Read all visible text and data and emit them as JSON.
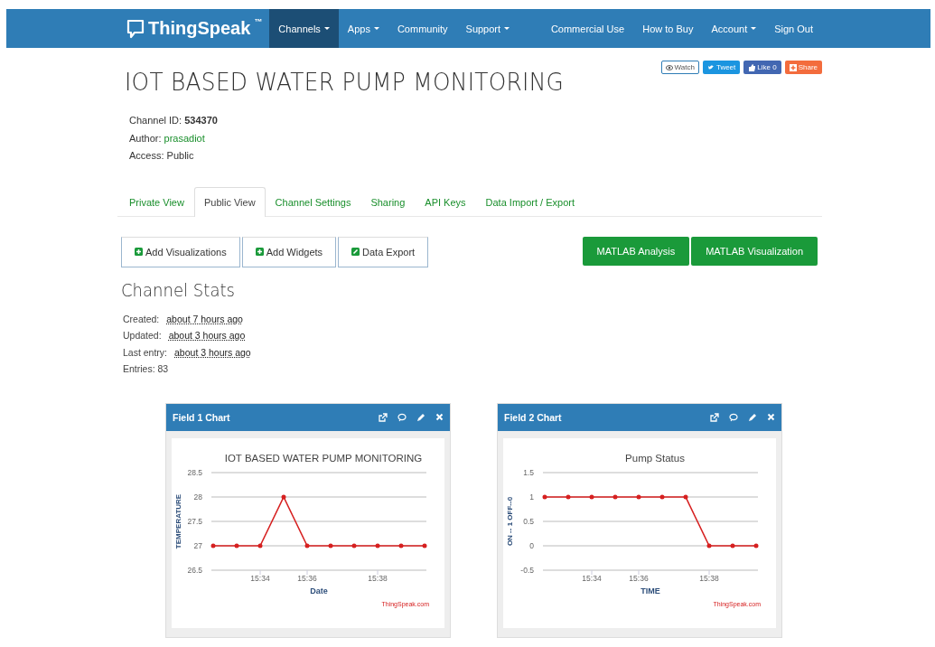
{
  "navbar": {
    "brand": "ThingSpeak",
    "trademark": "™",
    "items": [
      {
        "label": "Channels",
        "dropdown": true,
        "selected": true
      },
      {
        "label": "Apps",
        "dropdown": true,
        "selected": false
      },
      {
        "label": "Community",
        "dropdown": false,
        "selected": false
      },
      {
        "label": "Support",
        "dropdown": true,
        "selected": false
      }
    ],
    "right_items": [
      {
        "label": "Commercial Use",
        "dropdown": false,
        "selected": false
      },
      {
        "label": "How to Buy",
        "dropdown": false,
        "selected": false
      },
      {
        "label": "Account",
        "dropdown": true,
        "selected": false
      },
      {
        "label": "Sign Out",
        "dropdown": false,
        "selected": false
      }
    ]
  },
  "channel": {
    "title": "IOT BASED WATER PUMP MONITORING",
    "social_buttons": [
      {
        "kind": "watch",
        "label": "Watch"
      },
      {
        "kind": "tweet",
        "label": "Tweet"
      },
      {
        "kind": "like",
        "label": "Like 0"
      },
      {
        "kind": "share",
        "label": "Share"
      }
    ],
    "info": [
      {
        "label": "Channel ID:",
        "value": "534370",
        "kind": "bold"
      },
      {
        "label": "Author:",
        "value": "prasadiot",
        "kind": "link"
      },
      {
        "label": "Access:",
        "value": "Public",
        "kind": "plain"
      }
    ]
  },
  "tabs": [
    {
      "label": "Private View",
      "selected": false
    },
    {
      "label": "Public View",
      "selected": true
    },
    {
      "label": "Channel Settings",
      "selected": false
    },
    {
      "label": "Sharing",
      "selected": false
    },
    {
      "label": "API Keys",
      "selected": false
    },
    {
      "label": "Data Import / Export",
      "selected": false
    }
  ],
  "actions": [
    {
      "label": "Add Visualizations",
      "kind": "add"
    },
    {
      "label": "Add Widgets",
      "kind": "add"
    },
    {
      "label": "Data Export",
      "kind": "export"
    }
  ],
  "matlab_buttons": [
    "MATLAB Analysis",
    "MATLAB Visualization"
  ],
  "stats": {
    "heading": "Channel Stats",
    "rows": [
      {
        "label": "Created:",
        "value": "about 7 hours ago"
      },
      {
        "label": "Updated:",
        "value": "about 3 hours ago"
      },
      {
        "label": "Last entry:",
        "value": "about 3 hours ago"
      },
      {
        "label": "Entries: 83"
      }
    ]
  },
  "charts": [
    {
      "title": "Field 1 Chart",
      "credit": "ThingSpeak.com",
      "chart_data": {
        "type": "line",
        "title": "IOT BASED WATER PUMP MONITORING",
        "xlabel": "Date",
        "ylabel": "TEMPERATURE",
        "ylim": [
          26.5,
          28.5
        ],
        "yticks": [
          26.5,
          27,
          27.5,
          28,
          28.5
        ],
        "categories": [
          null,
          null,
          "15:34",
          null,
          "15:36",
          null,
          null,
          "15:38",
          null,
          null
        ],
        "grid": true,
        "series": [
          {
            "color": "#d62020",
            "values": [
              27,
              27,
              27,
              28,
              27,
              27,
              27,
              27,
              27,
              27
            ]
          }
        ]
      }
    },
    {
      "title": "Field 2 Chart",
      "credit": "ThingSpeak.com",
      "chart_data": {
        "type": "line",
        "title": "Pump Status",
        "xlabel": "TIME",
        "ylabel": "ON -- 1 OFF--0",
        "ylim": [
          -0.5,
          1.5
        ],
        "yticks": [
          -0.5,
          0,
          0.5,
          1,
          1.5
        ],
        "categories": [
          null,
          null,
          "15:34",
          null,
          "15:36",
          null,
          null,
          "15:38",
          null,
          null
        ],
        "grid": true,
        "series": [
          {
            "color": "#d62020",
            "values": [
              1,
              1,
              1,
              1,
              1,
              1,
              1,
              0,
              0,
              0
            ]
          }
        ]
      }
    }
  ]
}
